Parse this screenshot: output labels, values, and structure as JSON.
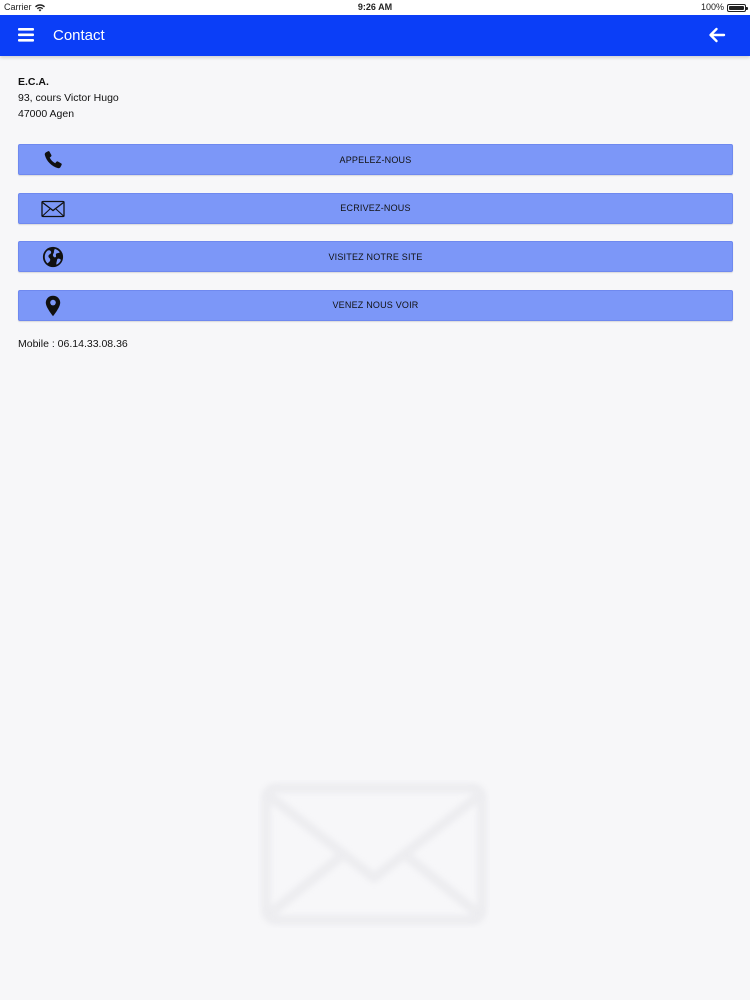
{
  "status_bar": {
    "carrier": "Carrier",
    "time": "9:26 AM",
    "battery": "100%"
  },
  "app_bar": {
    "title": "Contact",
    "color": "#0b3ef7",
    "menu_icon": "hamburger-menu-icon",
    "back_icon": "arrow-left-icon"
  },
  "address": {
    "name": "E.C.A.",
    "street": "93, cours Victor Hugo",
    "city": "47000 Agen"
  },
  "actions": [
    {
      "label": "APPELEZ-NOUS",
      "icon": "phone-icon"
    },
    {
      "label": "ECRIVEZ-NOUS",
      "icon": "envelope-icon"
    },
    {
      "label": "VISITEZ NOTRE SITE",
      "icon": "globe-icon"
    },
    {
      "label": "VENEZ NOUS VOIR",
      "icon": "map-pin-icon"
    }
  ],
  "button_color": "#7c97f8",
  "mobile": "Mobile : 06.14.33.08.36",
  "watermark_icon": "envelope-watermark-icon"
}
